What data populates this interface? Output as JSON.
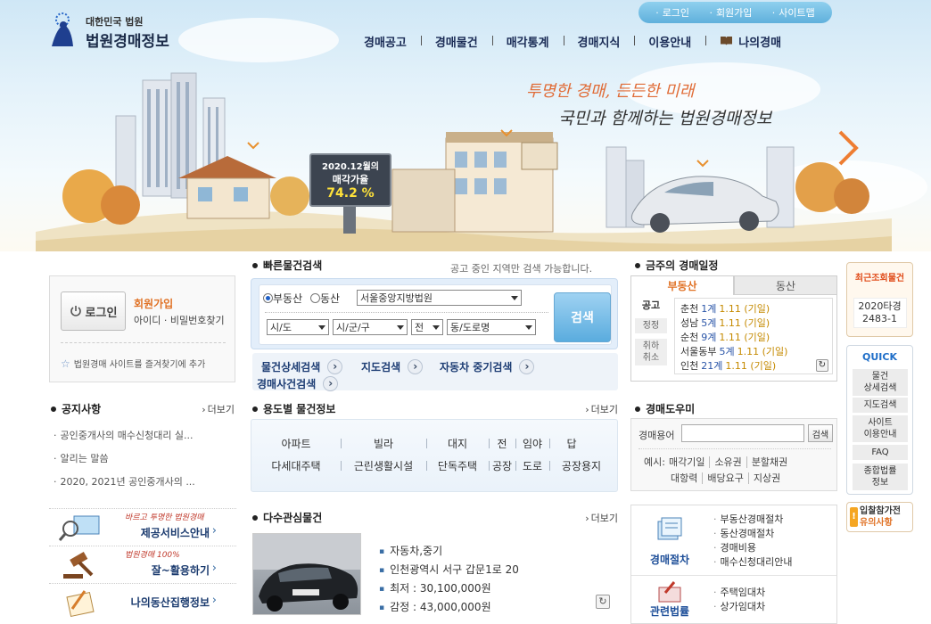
{
  "header": {
    "logo_small": "대한민국 법원",
    "logo_main": "법원경매정보",
    "util_links": [
      "로그인",
      "회원가입",
      "사이트맵"
    ],
    "nav": [
      "경매공고",
      "경매물건",
      "매각통계",
      "경매지식",
      "이용안내",
      "나의경매"
    ]
  },
  "hero": {
    "slogan_1": "투명한 경매, 든든한 미래",
    "slogan_2": "국민과 함께하는 법원경매정보",
    "billboard_line1": "2020.12월의",
    "billboard_line2": "매각가율",
    "billboard_rate": "74.2 %"
  },
  "login": {
    "button": "로그인",
    "join": "회원가입",
    "find": "아이디 · 비밀번호찾기",
    "favorite": "법원경매 사이트를 즐겨찾기에 추가"
  },
  "notice": {
    "title": "공지사항",
    "more": "더보기",
    "items": [
      "공인중개사의 매수신청대리 실...",
      "알리는 말씀",
      "2020, 2021년 공인중개사의 ..."
    ]
  },
  "promos": [
    {
      "sub": "바르고 투명한 법원경매",
      "label": "제공서비스안내"
    },
    {
      "sub": "법원경매 100%",
      "label": "잘~활용하기"
    },
    {
      "sub": "",
      "label": "나의동산집행정보"
    }
  ],
  "quick_search": {
    "title": "빠른물건검색",
    "hint": "공고 중인 지역만 검색 가능합니다.",
    "radio_1": "부동산",
    "radio_2": "동산",
    "court": "서울중앙지방법원",
    "sido": "시/도",
    "sigungu": "시/군/구",
    "jeon": "전",
    "dong": "동/도로명",
    "search_button": "검색",
    "links": [
      "물건상세검색",
      "지도검색",
      "자동차 중기검색",
      "경매사건검색"
    ]
  },
  "usage": {
    "title": "용도별 물건정보",
    "more": "더보기",
    "row1": [
      "아파트",
      "빌라",
      "대지",
      "전",
      "임야",
      "답"
    ],
    "row2": [
      "다세대주택",
      "근린생활시설",
      "단독주택",
      "공장",
      "도로",
      "공장용지"
    ]
  },
  "multi": {
    "title": "다수관심물건",
    "more": "더보기",
    "items": [
      "자동차,중기",
      "인천광역시 서구 갑문1로 20",
      "최저 : 30,100,000원",
      "감정 : 43,000,000원"
    ]
  },
  "schedule": {
    "title": "금주의 경매일정",
    "tab_1": "부동산",
    "tab_2": "동산",
    "side": [
      "공고",
      "정정",
      "취하\n취소"
    ],
    "entries": [
      {
        "court": "춘천",
        "num": "1계",
        "date": "1.11 (기일)"
      },
      {
        "court": "성남",
        "num": "5계",
        "date": "1.11 (기일)"
      },
      {
        "court": "순천",
        "num": "9계",
        "date": "1.11 (기일)"
      },
      {
        "court": "서울동부",
        "num": "5계",
        "date": "1.11 (기일)"
      },
      {
        "court": "인천",
        "num": "21계",
        "date": "1.11 (기일)"
      }
    ]
  },
  "helper": {
    "title": "경매도우미",
    "label": "경매용어",
    "button": "검색",
    "example_prefix": "예시:",
    "examples_1": [
      "매각기일",
      "소유권",
      "분할채권"
    ],
    "examples_2": [
      "대항력",
      "배당요구",
      "지상권"
    ]
  },
  "procedures": {
    "cat_1": "경매절차",
    "list_1": [
      "부동산경매절차",
      "동산경매절차",
      "경매비용",
      "매수신청대리안내"
    ],
    "cat_2": "관련법률",
    "list_2": [
      "주택임대차",
      "상가임대차"
    ]
  },
  "rail": {
    "recent_title": "최근조회물건",
    "recent_value": "2020타경\n2483-1",
    "quick_title": "QUICK",
    "quick_items": [
      "물건\n상세검색",
      "지도검색",
      "사이트\n이용안내",
      "FAQ",
      "종합법률\n정보"
    ],
    "notice_1": "입찰참가전",
    "notice_2": "유의사항"
  },
  "colors": {
    "nav_text": "#1a2b55",
    "accent_orange": "#e07124",
    "search_blue": "#5aacde"
  }
}
